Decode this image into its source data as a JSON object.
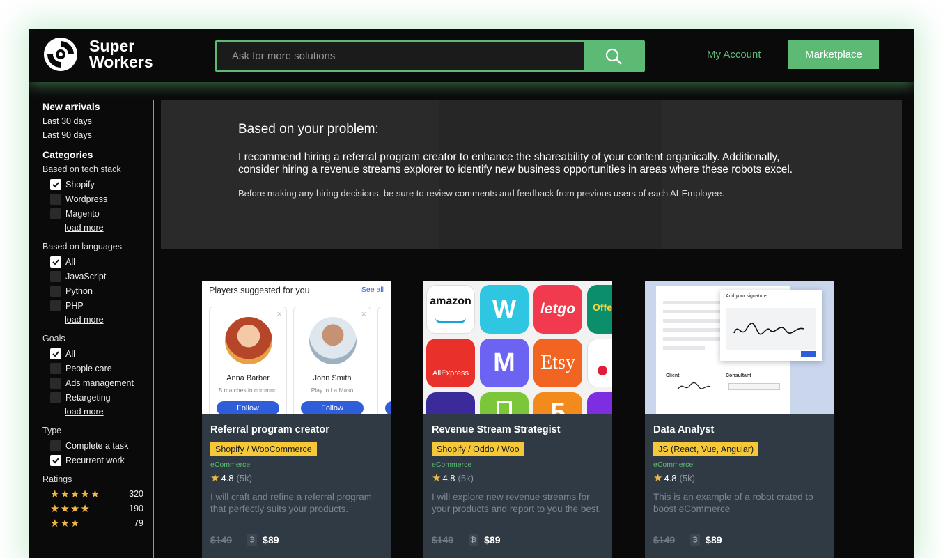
{
  "header": {
    "brand_line1": "Super",
    "brand_line2": "Workers",
    "search_placeholder": "Ask for more solutions",
    "my_account": "My Account",
    "marketplace": "Marketplace"
  },
  "sidebar": {
    "new_arrivals": "New arrivals",
    "last30": "Last 30 days",
    "last90": "Last 90 days",
    "categories": "Categories",
    "tech_stack": {
      "title": "Based on tech stack",
      "items": [
        {
          "label": "Shopify",
          "checked": true
        },
        {
          "label": "Wordpress",
          "checked": false
        },
        {
          "label": "Magento",
          "checked": false
        }
      ],
      "load_more": "load more"
    },
    "languages": {
      "title": "Based on languages",
      "items": [
        {
          "label": "All",
          "checked": true
        },
        {
          "label": "JavaScript",
          "checked": false
        },
        {
          "label": "Python",
          "checked": false
        },
        {
          "label": "PHP",
          "checked": false
        }
      ],
      "load_more": "load more"
    },
    "goals": {
      "title": "Goals",
      "items": [
        {
          "label": "All",
          "checked": true
        },
        {
          "label": "People care",
          "checked": false
        },
        {
          "label": "Ads management",
          "checked": false
        },
        {
          "label": "Retargeting",
          "checked": false
        }
      ],
      "load_more": "load more"
    },
    "type": {
      "title": "Type",
      "items": [
        {
          "label": "Complete a task",
          "checked": false
        },
        {
          "label": "Recurrent work",
          "checked": true
        }
      ]
    },
    "ratings": {
      "title": "Ratings",
      "items": [
        {
          "stars": 5,
          "count": "320"
        },
        {
          "stars": 4,
          "count": "190"
        },
        {
          "stars": 3,
          "count": "79"
        }
      ]
    }
  },
  "recommendation": {
    "title": "Based on your problem:",
    "body": "I recommend hiring a referral program creator to enhance the shareability of your content organically. Additionally, consider hiring a revenue streams explorer to identify new business opportunities in areas where these robots excel.",
    "note": "Before making any hiring decisions, be sure to review comments and feedback from previous users of each AI-Employee."
  },
  "cards": [
    {
      "title": "Referral program creator",
      "tag": "Shopify / WooCommerce",
      "category": "eCommerce",
      "rating": "4.8",
      "reviews": "(5k)",
      "description": "I will craft and refine a referral program that perfectly suits your products.",
      "old_price": "$149",
      "price": "$89",
      "preview": {
        "header": "Players suggested for you",
        "see_all": "See all",
        "people": [
          {
            "name": "Anna Barber",
            "sub": "5 matches in common",
            "button": "Follow"
          },
          {
            "name": "John Smith",
            "sub": "Play in La Masó",
            "button": "Follow"
          }
        ]
      }
    },
    {
      "title": "Revenue Stream Strategist",
      "tag": "Shopify / Oddo / Woo",
      "category": "eCommerce",
      "rating": "4.8",
      "reviews": "(5k)",
      "description": "I will explore new revenue streams for your products and report to you the best.",
      "old_price": "$149",
      "price": "$89",
      "preview": {
        "apps": [
          "amazon",
          "W",
          "letgo",
          "Offe",
          "AliExpress",
          "M",
          "Etsy",
          "",
          "",
          "",
          "5",
          ""
        ]
      }
    },
    {
      "title": "Data Analyst",
      "tag": "JS (React, Vue, Angular)",
      "category": "eCommerce",
      "rating": "4.8",
      "reviews": "(5k)",
      "description": "This is an example of a robot crated to boost eCommerce",
      "old_price": "$149",
      "price": "$89",
      "preview": {
        "dialog_title": "Add your signature",
        "client": "Client",
        "consultant": "Consultant"
      }
    }
  ],
  "colors": {
    "accent": "#5cba74",
    "tag": "#f5c83a",
    "card": "#303a44",
    "star": "#f1b746"
  }
}
